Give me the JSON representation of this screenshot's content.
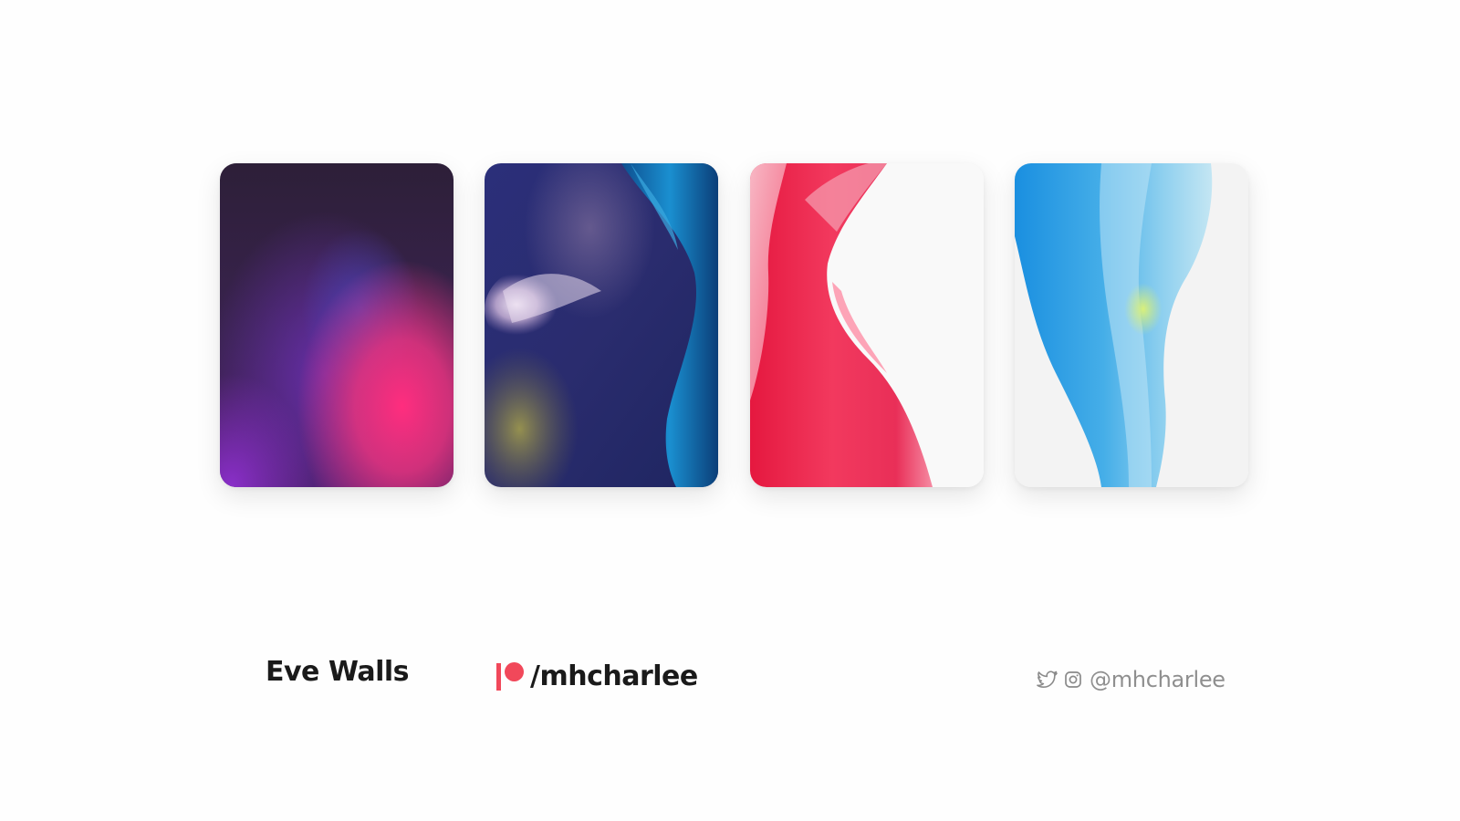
{
  "wallpapers": [
    {
      "label": "Eve Walls wallpaper 1",
      "palette": "purple-pink"
    },
    {
      "label": "Eve Walls wallpaper 2",
      "palette": "navy-silk-blue"
    },
    {
      "label": "Eve Walls wallpaper 3",
      "palette": "red-glass-on-white"
    },
    {
      "label": "Eve Walls wallpaper 4",
      "palette": "blue-glass-on-white"
    }
  ],
  "footer": {
    "title": "Eve Walls",
    "patreon_handle": "/mhcharlee",
    "social_handle": "@mhcharlee"
  },
  "colors": {
    "patreon_red": "#f1485a",
    "text_dark": "#1a1a1a",
    "text_muted": "#8f8f8f"
  },
  "icons": [
    "patreon-logo-icon",
    "twitter-icon",
    "instagram-icon"
  ]
}
